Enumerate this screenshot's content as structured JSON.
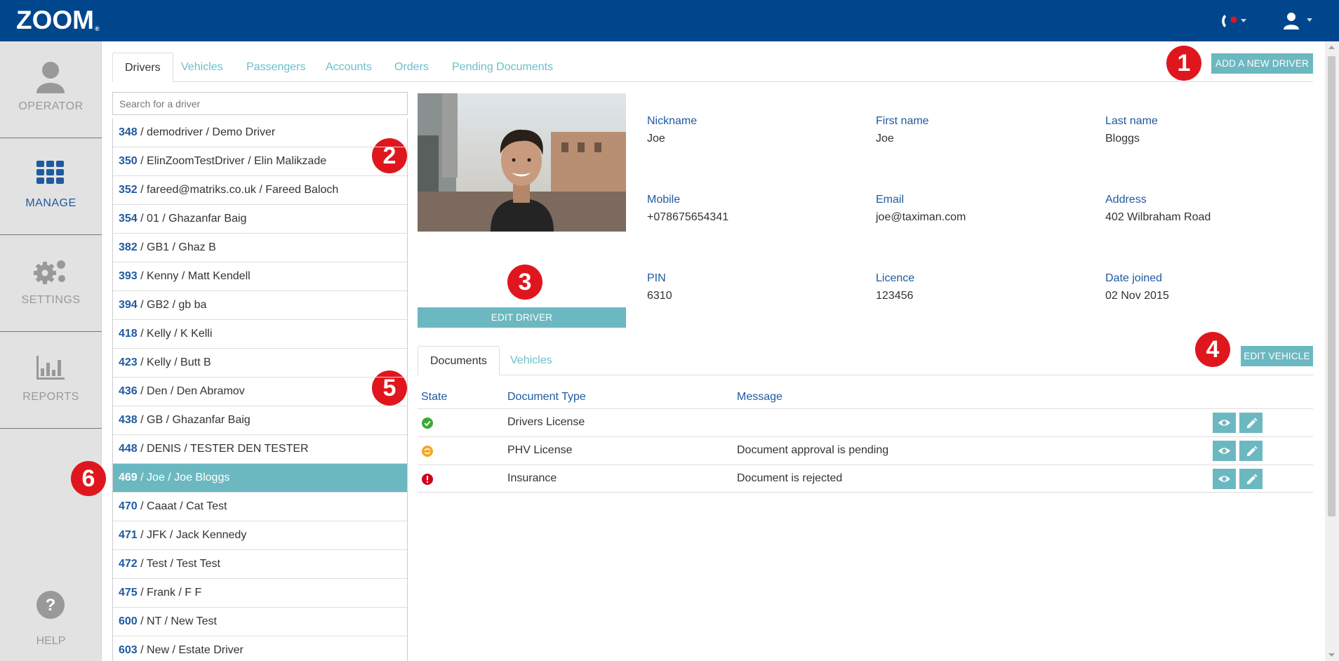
{
  "header": {
    "logo": "ZOOM",
    "logo_mark": "®",
    "phone_icon": "phone-icon",
    "status_color": "#e0161e",
    "user_icon": "user-icon"
  },
  "sidebar": {
    "items": [
      {
        "label": "OPERATOR",
        "icon": "user-icon",
        "active": false
      },
      {
        "label": "MANAGE",
        "icon": "grid-icon",
        "active": true
      },
      {
        "label": "SETTINGS",
        "icon": "gears-icon",
        "active": false
      },
      {
        "label": "REPORTS",
        "icon": "bar-chart-icon",
        "active": false
      }
    ],
    "help": {
      "label": "HELP",
      "icon": "question-icon"
    }
  },
  "tabs": [
    {
      "label": "Drivers",
      "active": true
    },
    {
      "label": "Vehicles",
      "active": false
    },
    {
      "label": "Passengers",
      "active": false
    },
    {
      "label": "Accounts",
      "active": false
    },
    {
      "label": "Orders",
      "active": false
    },
    {
      "label": "Pending Documents",
      "active": false
    }
  ],
  "buttons": {
    "add_driver": "ADD A NEW DRIVER",
    "edit_driver": "EDIT DRIVER",
    "edit_vehicle": "EDIT VEHICLE"
  },
  "badges": [
    "1",
    "2",
    "3",
    "4",
    "5",
    "6"
  ],
  "search": {
    "placeholder": "Search for a driver",
    "value": ""
  },
  "drivers": [
    {
      "id": "348",
      "text": " / demodriver / Demo Driver"
    },
    {
      "id": "350",
      "text": " / ElinZoomTestDriver / Elin Malikzade"
    },
    {
      "id": "352",
      "text": " / fareed@matriks.co.uk / Fareed Baloch"
    },
    {
      "id": "354",
      "text": " / 01 / Ghazanfar Baig"
    },
    {
      "id": "382",
      "text": " / GB1 / Ghaz B"
    },
    {
      "id": "393",
      "text": " / Kenny / Matt Kendell"
    },
    {
      "id": "394",
      "text": " / GB2 / gb ba"
    },
    {
      "id": "418",
      "text": " / Kelly / K Kelli"
    },
    {
      "id": "423",
      "text": " / Kelly / Butt B"
    },
    {
      "id": "436",
      "text": " / Den / Den Abramov"
    },
    {
      "id": "438",
      "text": " / GB / Ghazanfar Baig"
    },
    {
      "id": "448",
      "text": " / DENIS / TESTER DEN TESTER"
    },
    {
      "id": "469",
      "text": " / Joe / Joe Bloggs",
      "selected": true
    },
    {
      "id": "470",
      "text": " / Caaat / Cat Test"
    },
    {
      "id": "471",
      "text": " / JFK / Jack Kennedy"
    },
    {
      "id": "472",
      "text": " / Test / Test Test"
    },
    {
      "id": "475",
      "text": " / Frank / F F"
    },
    {
      "id": "600",
      "text": " / NT / New Test"
    },
    {
      "id": "603",
      "text": " / New / Estate Driver"
    }
  ],
  "details": {
    "nickname": {
      "label": "Nickname",
      "value": "Joe"
    },
    "first_name": {
      "label": "First name",
      "value": "Joe"
    },
    "last_name": {
      "label": "Last name",
      "value": "Bloggs"
    },
    "mobile": {
      "label": "Mobile",
      "value": "+078675654341"
    },
    "email": {
      "label": "Email",
      "value": "joe@taximan.com"
    },
    "address": {
      "label": "Address",
      "value": "402 Wilbraham Road"
    },
    "pin": {
      "label": "PIN",
      "value": "6310"
    },
    "licence": {
      "label": "Licence",
      "value": "123456"
    },
    "date_joined": {
      "label": "Date joined",
      "value": "02 Nov 2015"
    }
  },
  "subtabs": [
    {
      "label": "Documents",
      "active": true
    },
    {
      "label": "Vehicles",
      "active": false
    }
  ],
  "documents": {
    "headers": {
      "state": "State",
      "type": "Document Type",
      "message": "Message"
    },
    "rows": [
      {
        "state": "approved",
        "state_color": "#3aaa35",
        "type": "Drivers License",
        "message": ""
      },
      {
        "state": "pending",
        "state_color": "#f5a623",
        "type": "PHV License",
        "message": "Document approval is pending"
      },
      {
        "state": "rejected",
        "state_color": "#d0021b",
        "type": "Insurance",
        "message": "Document is rejected"
      }
    ]
  },
  "colors": {
    "header": "#00468c",
    "accent": "#6cb8c1",
    "link": "#1f5aa0",
    "badge": "#e0161e"
  }
}
